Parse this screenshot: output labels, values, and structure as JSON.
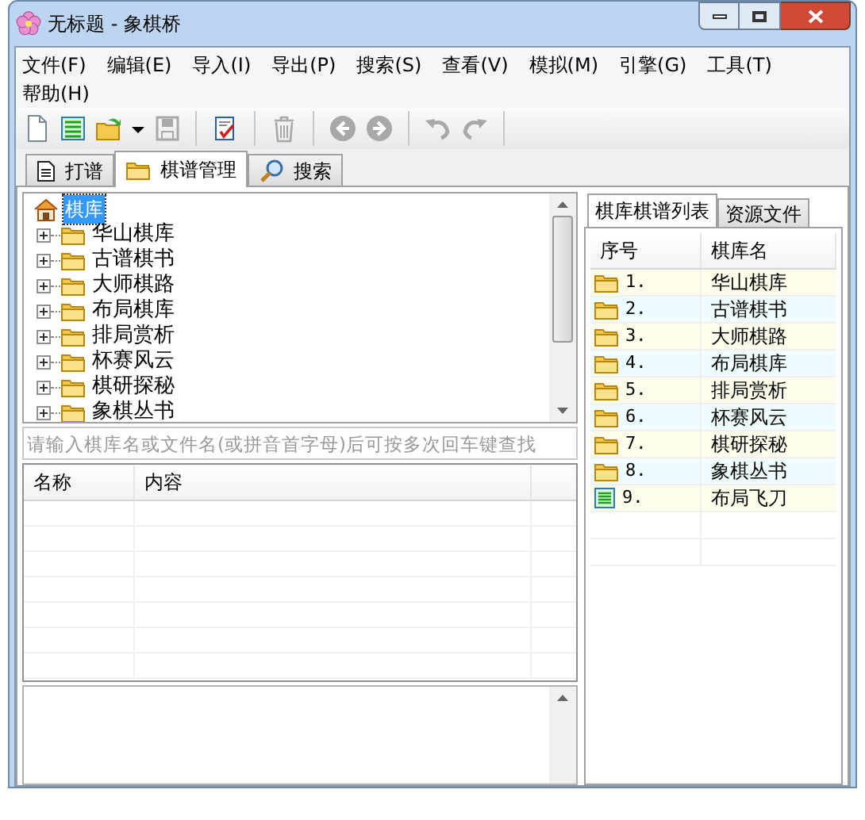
{
  "window": {
    "title": "无标题 - 象棋桥"
  },
  "menu": [
    "文件(F)",
    "编辑(E)",
    "导入(I)",
    "导出(P)",
    "搜索(S)",
    "查看(V)",
    "模拟(M)",
    "引擎(G)",
    "工具(T)",
    "帮助(H)"
  ],
  "toolbar": [
    {
      "kind": "new",
      "disabled": false
    },
    {
      "kind": "list",
      "disabled": false
    },
    {
      "kind": "open",
      "disabled": false
    },
    {
      "kind": "dropdown",
      "disabled": false
    },
    {
      "kind": "save",
      "disabled": true
    },
    {
      "kind": "sep"
    },
    {
      "kind": "check",
      "disabled": false
    },
    {
      "kind": "sep"
    },
    {
      "kind": "delete",
      "disabled": true
    },
    {
      "kind": "sep"
    },
    {
      "kind": "back",
      "disabled": true
    },
    {
      "kind": "forward",
      "disabled": true
    },
    {
      "kind": "sep"
    },
    {
      "kind": "undo",
      "disabled": true
    },
    {
      "kind": "redo",
      "disabled": true
    },
    {
      "kind": "sep"
    }
  ],
  "tabs": [
    {
      "label": "打谱",
      "kind": "doc",
      "selected": false
    },
    {
      "label": "棋谱管理",
      "kind": "folder",
      "selected": true
    },
    {
      "label": "搜索",
      "kind": "search",
      "selected": false
    }
  ],
  "tree": {
    "label": "棋库",
    "selected": true,
    "children": [
      {
        "label": "华山棋库",
        "expanded": false
      },
      {
        "label": "古谱棋书",
        "expanded": false
      },
      {
        "label": "大师棋路",
        "expanded": false
      },
      {
        "label": "布局棋库",
        "expanded": false
      },
      {
        "label": "排局赏析",
        "expanded": false
      },
      {
        "label": "杯赛风云",
        "expanded": false
      },
      {
        "label": "棋研探秘",
        "expanded": false
      },
      {
        "label": "象棋丛书",
        "expanded": false
      }
    ]
  },
  "search": {
    "placeholder": "请输入棋库名或文件名(或拼音首字母)后可按多次回车键查找"
  },
  "info_table": {
    "columns": [
      "名称",
      "内容"
    ]
  },
  "right_tabs": [
    {
      "label": "棋库棋谱列表",
      "selected": true
    },
    {
      "label": "资源文件",
      "selected": false
    }
  ],
  "list": {
    "columns": [
      "序号",
      "棋库名"
    ],
    "rows": [
      {
        "kind": "folder",
        "index": "1.",
        "name": "华山棋库"
      },
      {
        "kind": "folder",
        "index": "2.",
        "name": "古谱棋书"
      },
      {
        "kind": "folder",
        "index": "3.",
        "name": "大师棋路"
      },
      {
        "kind": "folder",
        "index": "4.",
        "name": "布局棋库"
      },
      {
        "kind": "folder",
        "index": "5.",
        "name": "排局赏析"
      },
      {
        "kind": "folder",
        "index": "6.",
        "name": "杯赛风云"
      },
      {
        "kind": "folder",
        "index": "7.",
        "name": "棋研探秘"
      },
      {
        "kind": "folder",
        "index": "8.",
        "name": "象棋丛书"
      },
      {
        "kind": "file",
        "index": "9.",
        "name": "布局飞刀"
      }
    ]
  }
}
